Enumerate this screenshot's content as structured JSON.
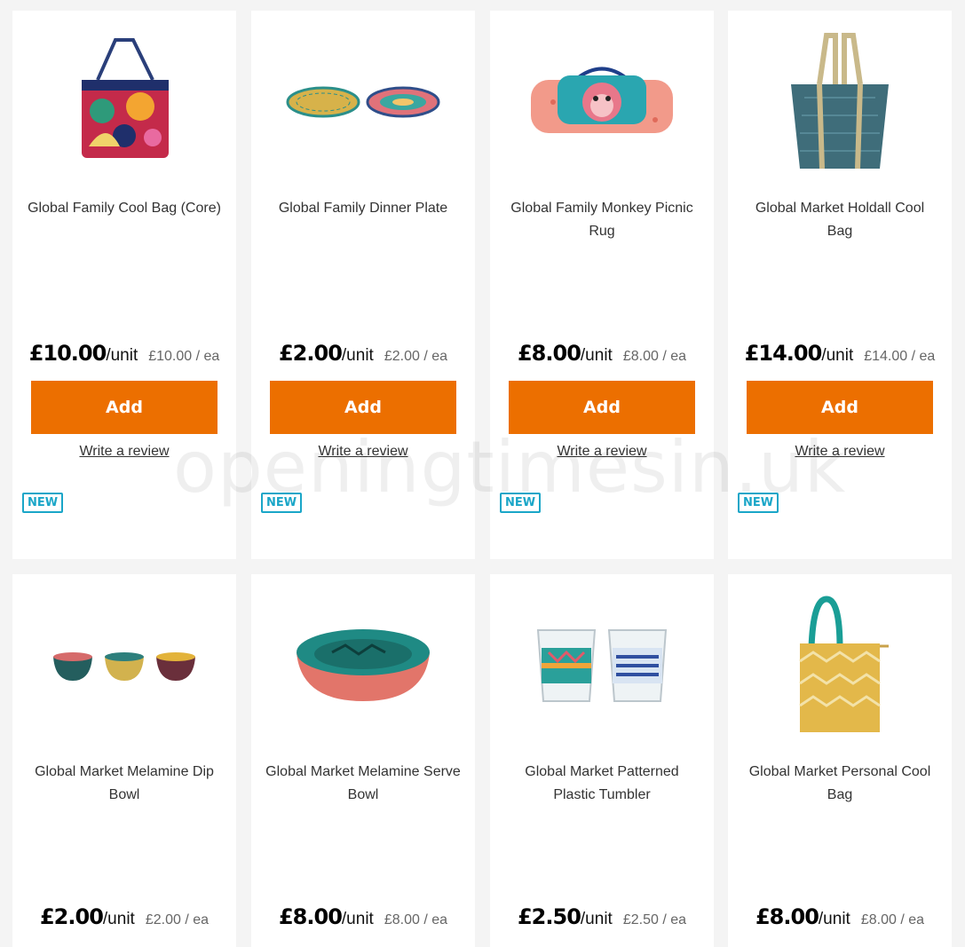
{
  "products": [
    {
      "name": "Global Family Cool Bag (Core)",
      "price": "£10.00",
      "unit": "/unit",
      "each": "£10.00 / ea",
      "add": "Add",
      "review": "Write a review",
      "badge": "NEW",
      "icon": "floral-cool-bag-image"
    },
    {
      "name": "Global Family Dinner Plate",
      "price": "£2.00",
      "unit": "/unit",
      "each": "£2.00 / ea",
      "add": "Add",
      "review": "Write a review",
      "badge": "NEW",
      "icon": "dinner-plates-image"
    },
    {
      "name": "Global Family Monkey Picnic Rug",
      "price": "£8.00",
      "unit": "/unit",
      "each": "£8.00 / ea",
      "add": "Add",
      "review": "Write a review",
      "badge": "NEW",
      "icon": "monkey-picnic-rug-image"
    },
    {
      "name": "Global Market Holdall Cool Bag",
      "price": "£14.00",
      "unit": "/unit",
      "each": "£14.00 / ea",
      "add": "Add",
      "review": "Write a review",
      "badge": "NEW",
      "icon": "holdall-cool-bag-image"
    },
    {
      "name": "Global Market Melamine Dip Bowl",
      "price": "£2.00",
      "unit": "/unit",
      "each": "£2.00 / ea",
      "icon": "dip-bowls-image"
    },
    {
      "name": "Global Market Melamine Serve Bowl",
      "price": "£8.00",
      "unit": "/unit",
      "each": "£8.00 / ea",
      "icon": "serve-bowl-image"
    },
    {
      "name": "Global Market Patterned Plastic Tumbler",
      "price": "£2.50",
      "unit": "/unit",
      "each": "£2.50 / ea",
      "icon": "tumblers-image"
    },
    {
      "name": "Global Market Personal Cool Bag",
      "price": "£8.00",
      "unit": "/unit",
      "each": "£8.00 / ea",
      "icon": "personal-cool-bag-image"
    }
  ],
  "watermark": "openingtimesin.uk",
  "colors": {
    "add_button": "#ec6f00",
    "new_badge": "#1aa6c8",
    "background": "#f4f4f4"
  }
}
